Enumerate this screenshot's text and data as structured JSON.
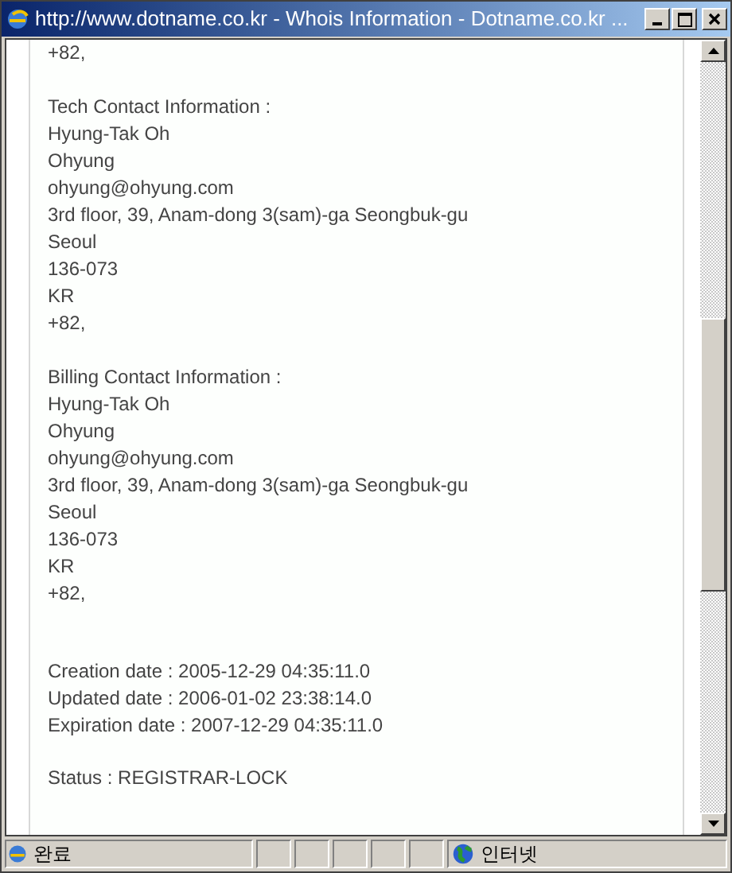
{
  "window": {
    "title": "http://www.dotname.co.kr - Whois Information - Dotname.co.kr ..."
  },
  "sections": [
    {
      "kind": "tail",
      "lines": [
        "+82,"
      ]
    },
    {
      "kind": "contact",
      "lines": [
        "Tech Contact Information :",
        "Hyung-Tak Oh",
        "Ohyung",
        "ohyung@ohyung.com",
        "3rd floor, 39, Anam-dong 3(sam)-ga Seongbuk-gu",
        "Seoul",
        "136-073",
        "KR",
        "+82,"
      ]
    },
    {
      "kind": "contact",
      "lines": [
        "Billing Contact Information :",
        "Hyung-Tak Oh",
        "Ohyung",
        "ohyung@ohyung.com",
        "3rd floor, 39, Anam-dong 3(sam)-ga Seongbuk-gu",
        "Seoul",
        "136-073",
        "KR",
        "+82,"
      ]
    },
    {
      "kind": "dates",
      "lines": [
        "Creation date : 2005-12-29 04:35:11.0",
        "Updated date : 2006-01-02 23:38:14.0",
        "Expiration date : 2007-12-29 04:35:11.0"
      ]
    },
    {
      "kind": "status",
      "lines": [
        "Status : REGISTRAR-LOCK"
      ]
    }
  ],
  "status_bar": {
    "text": "완료",
    "zone": "인터넷"
  }
}
